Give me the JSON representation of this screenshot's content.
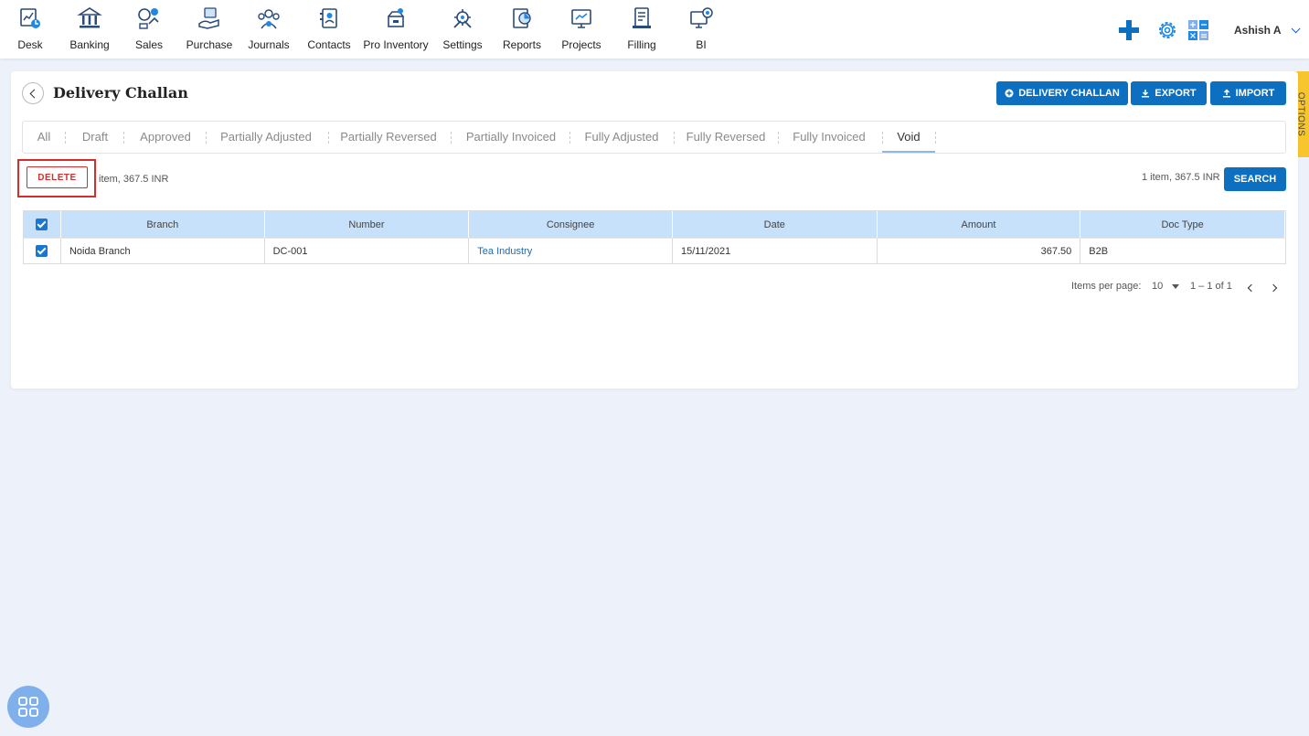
{
  "nav": {
    "items": [
      {
        "label": "Desk",
        "icon": "desk-icon"
      },
      {
        "label": "Banking",
        "icon": "bank-icon"
      },
      {
        "label": "Sales",
        "icon": "sales-icon"
      },
      {
        "label": "Purchase",
        "icon": "purchase-icon"
      },
      {
        "label": "Journals",
        "icon": "journals-icon"
      },
      {
        "label": "Contacts",
        "icon": "contacts-icon"
      },
      {
        "label": "Pro Inventory",
        "icon": "inventory-icon"
      },
      {
        "label": "Settings",
        "icon": "settings-icon"
      },
      {
        "label": "Reports",
        "icon": "reports-icon"
      },
      {
        "label": "Projects",
        "icon": "projects-icon"
      },
      {
        "label": "Filling",
        "icon": "filling-icon"
      },
      {
        "label": "BI",
        "icon": "bi-icon"
      }
    ],
    "user_name": "Ashish A"
  },
  "options_tab": "OPTIONS",
  "page": {
    "title": "Delivery Challan",
    "buttons": {
      "new": "DELIVERY CHALLAN",
      "export": "EXPORT",
      "import": "IMPORT"
    }
  },
  "tabs": [
    "All",
    "Draft",
    "Approved",
    "Partially Adjusted",
    "Partially Reversed",
    "Partially Invoiced",
    "Fully Adjusted",
    "Fully Reversed",
    "Fully Invoiced",
    "Void"
  ],
  "active_tab": "Void",
  "actions": {
    "delete_label": "DELETE",
    "selection_summary": "item, 367.5 INR",
    "total_summary": "1 item, 367.5 INR",
    "search_label": "SEARCH"
  },
  "table": {
    "columns": [
      "Branch",
      "Number",
      "Consignee",
      "Date",
      "Amount",
      "Doc Type"
    ],
    "rows": [
      {
        "branch": "Noida Branch",
        "number": "DC-001",
        "consignee": "Tea Industry",
        "date": "15/11/2021",
        "amount": "367.50",
        "doc_type": "B2B",
        "checked": true
      }
    ]
  },
  "paginator": {
    "label": "Items per page:",
    "page_size": "10",
    "range": "1 – 1 of 1"
  },
  "colors": {
    "primary": "#0c6fbf",
    "danger": "#d32f2f",
    "header_bg": "#c6e1f9",
    "options_tab": "#f7c52d",
    "page_bg": "#edf1fa"
  }
}
